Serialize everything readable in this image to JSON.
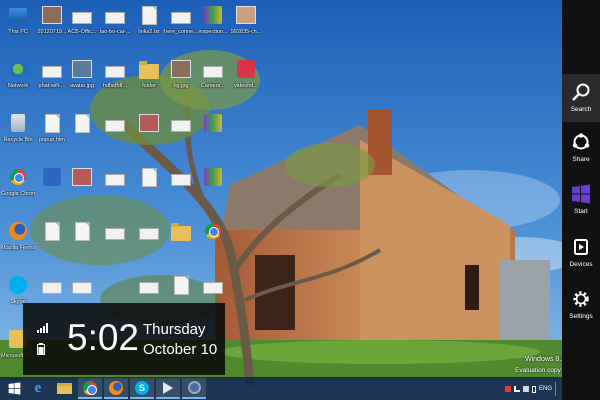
{
  "desktop": {
    "icons": [
      {
        "label": "This PC",
        "icon": "computer-icon"
      },
      {
        "label": "20120719...",
        "icon": "photo-icon"
      },
      {
        "label": "ACB-Offic...",
        "icon": "image-icon"
      },
      {
        "label": "tao-bo-cai-...",
        "icon": "image-icon"
      },
      {
        "label": "links2.txt",
        "icon": "text-file-icon"
      },
      {
        "label": "here_conne...",
        "icon": "image-icon"
      },
      {
        "label": "inspection...",
        "icon": "archive-icon"
      },
      {
        "label": "992835-ch...",
        "icon": "photo-icon"
      },
      {
        "label": "Network",
        "icon": "network-icon"
      },
      {
        "label": "phat-wifi-...",
        "icon": "image-icon"
      },
      {
        "label": "avatar.jpg",
        "icon": "photo-icon"
      },
      {
        "label": "hdfsdfdf...",
        "icon": "image-icon"
      },
      {
        "label": "folder",
        "icon": "folder-icon"
      },
      {
        "label": "bg.jpg",
        "icon": "photo-icon"
      },
      {
        "label": "Camera...",
        "icon": "image-icon"
      },
      {
        "label": "videohd...",
        "icon": "video-icon"
      },
      {
        "label": "Recycle Bin",
        "icon": "recycle-bin-icon"
      },
      {
        "label": "popup.htm",
        "icon": "document-icon"
      },
      {
        "label": "Google Chrome",
        "icon": "chrome-icon"
      },
      {
        "label": "Mozilla Firefox",
        "icon": "firefox-icon"
      },
      {
        "label": "Skype",
        "icon": "skype-icon"
      },
      {
        "label": "Microsoft Office",
        "icon": "office-icon"
      },
      {
        "label": "",
        "icon": "document-icon"
      },
      {
        "label": "",
        "icon": "image-icon"
      },
      {
        "label": "",
        "icon": "photo-icon"
      },
      {
        "label": "",
        "icon": "image-icon"
      },
      {
        "label": "",
        "icon": "archive-icon"
      },
      {
        "label": "",
        "icon": "shield-icon"
      },
      {
        "label": "",
        "icon": "photo-icon"
      },
      {
        "label": "",
        "icon": "image-icon"
      },
      {
        "label": "",
        "icon": "document-icon"
      },
      {
        "label": "",
        "icon": "image-icon"
      },
      {
        "label": "",
        "icon": "archive-icon"
      },
      {
        "label": "",
        "icon": "document-icon"
      },
      {
        "label": "",
        "icon": "document-icon"
      },
      {
        "label": "",
        "icon": "image-icon"
      },
      {
        "label": "",
        "icon": "image-icon"
      },
      {
        "label": "",
        "icon": "folder-icon"
      },
      {
        "label": "",
        "icon": "chrome-icon"
      },
      {
        "label": "",
        "icon": "image-icon"
      },
      {
        "label": "",
        "icon": "image-icon"
      },
      {
        "label": "",
        "icon": "image-icon"
      },
      {
        "label": "",
        "icon": "document-icon"
      },
      {
        "label": "",
        "icon": "image-icon"
      }
    ]
  },
  "clock": {
    "time": "5:02",
    "day": "Thursday",
    "date": "October 10",
    "network_icon": "signal-icon",
    "battery_icon": "battery-icon"
  },
  "charms": [
    {
      "label": "Search",
      "icon": "search-icon"
    },
    {
      "label": "Share",
      "icon": "share-icon"
    },
    {
      "label": "Start",
      "icon": "windows-icon"
    },
    {
      "label": "Devices",
      "icon": "devices-icon"
    },
    {
      "label": "Settings",
      "icon": "gear-icon"
    }
  ],
  "taskbar": {
    "start_icon": "windows-icon",
    "pinned": [
      "internet-explorer-icon",
      "file-explorer-icon",
      "chrome-icon",
      "firefox-icon",
      "skype-icon",
      "media-player-icon",
      "app-icon"
    ],
    "tray": {
      "lang": "ENG"
    }
  },
  "watermark": {
    "line1": "Windows 8.1",
    "line2": "Evaluation copy"
  },
  "colors": {
    "charms_bg": "#111111",
    "taskbar_bg": "#122a46",
    "clock_overlay_bg": "#0a0a0a",
    "sky": "#2f6fc2"
  }
}
